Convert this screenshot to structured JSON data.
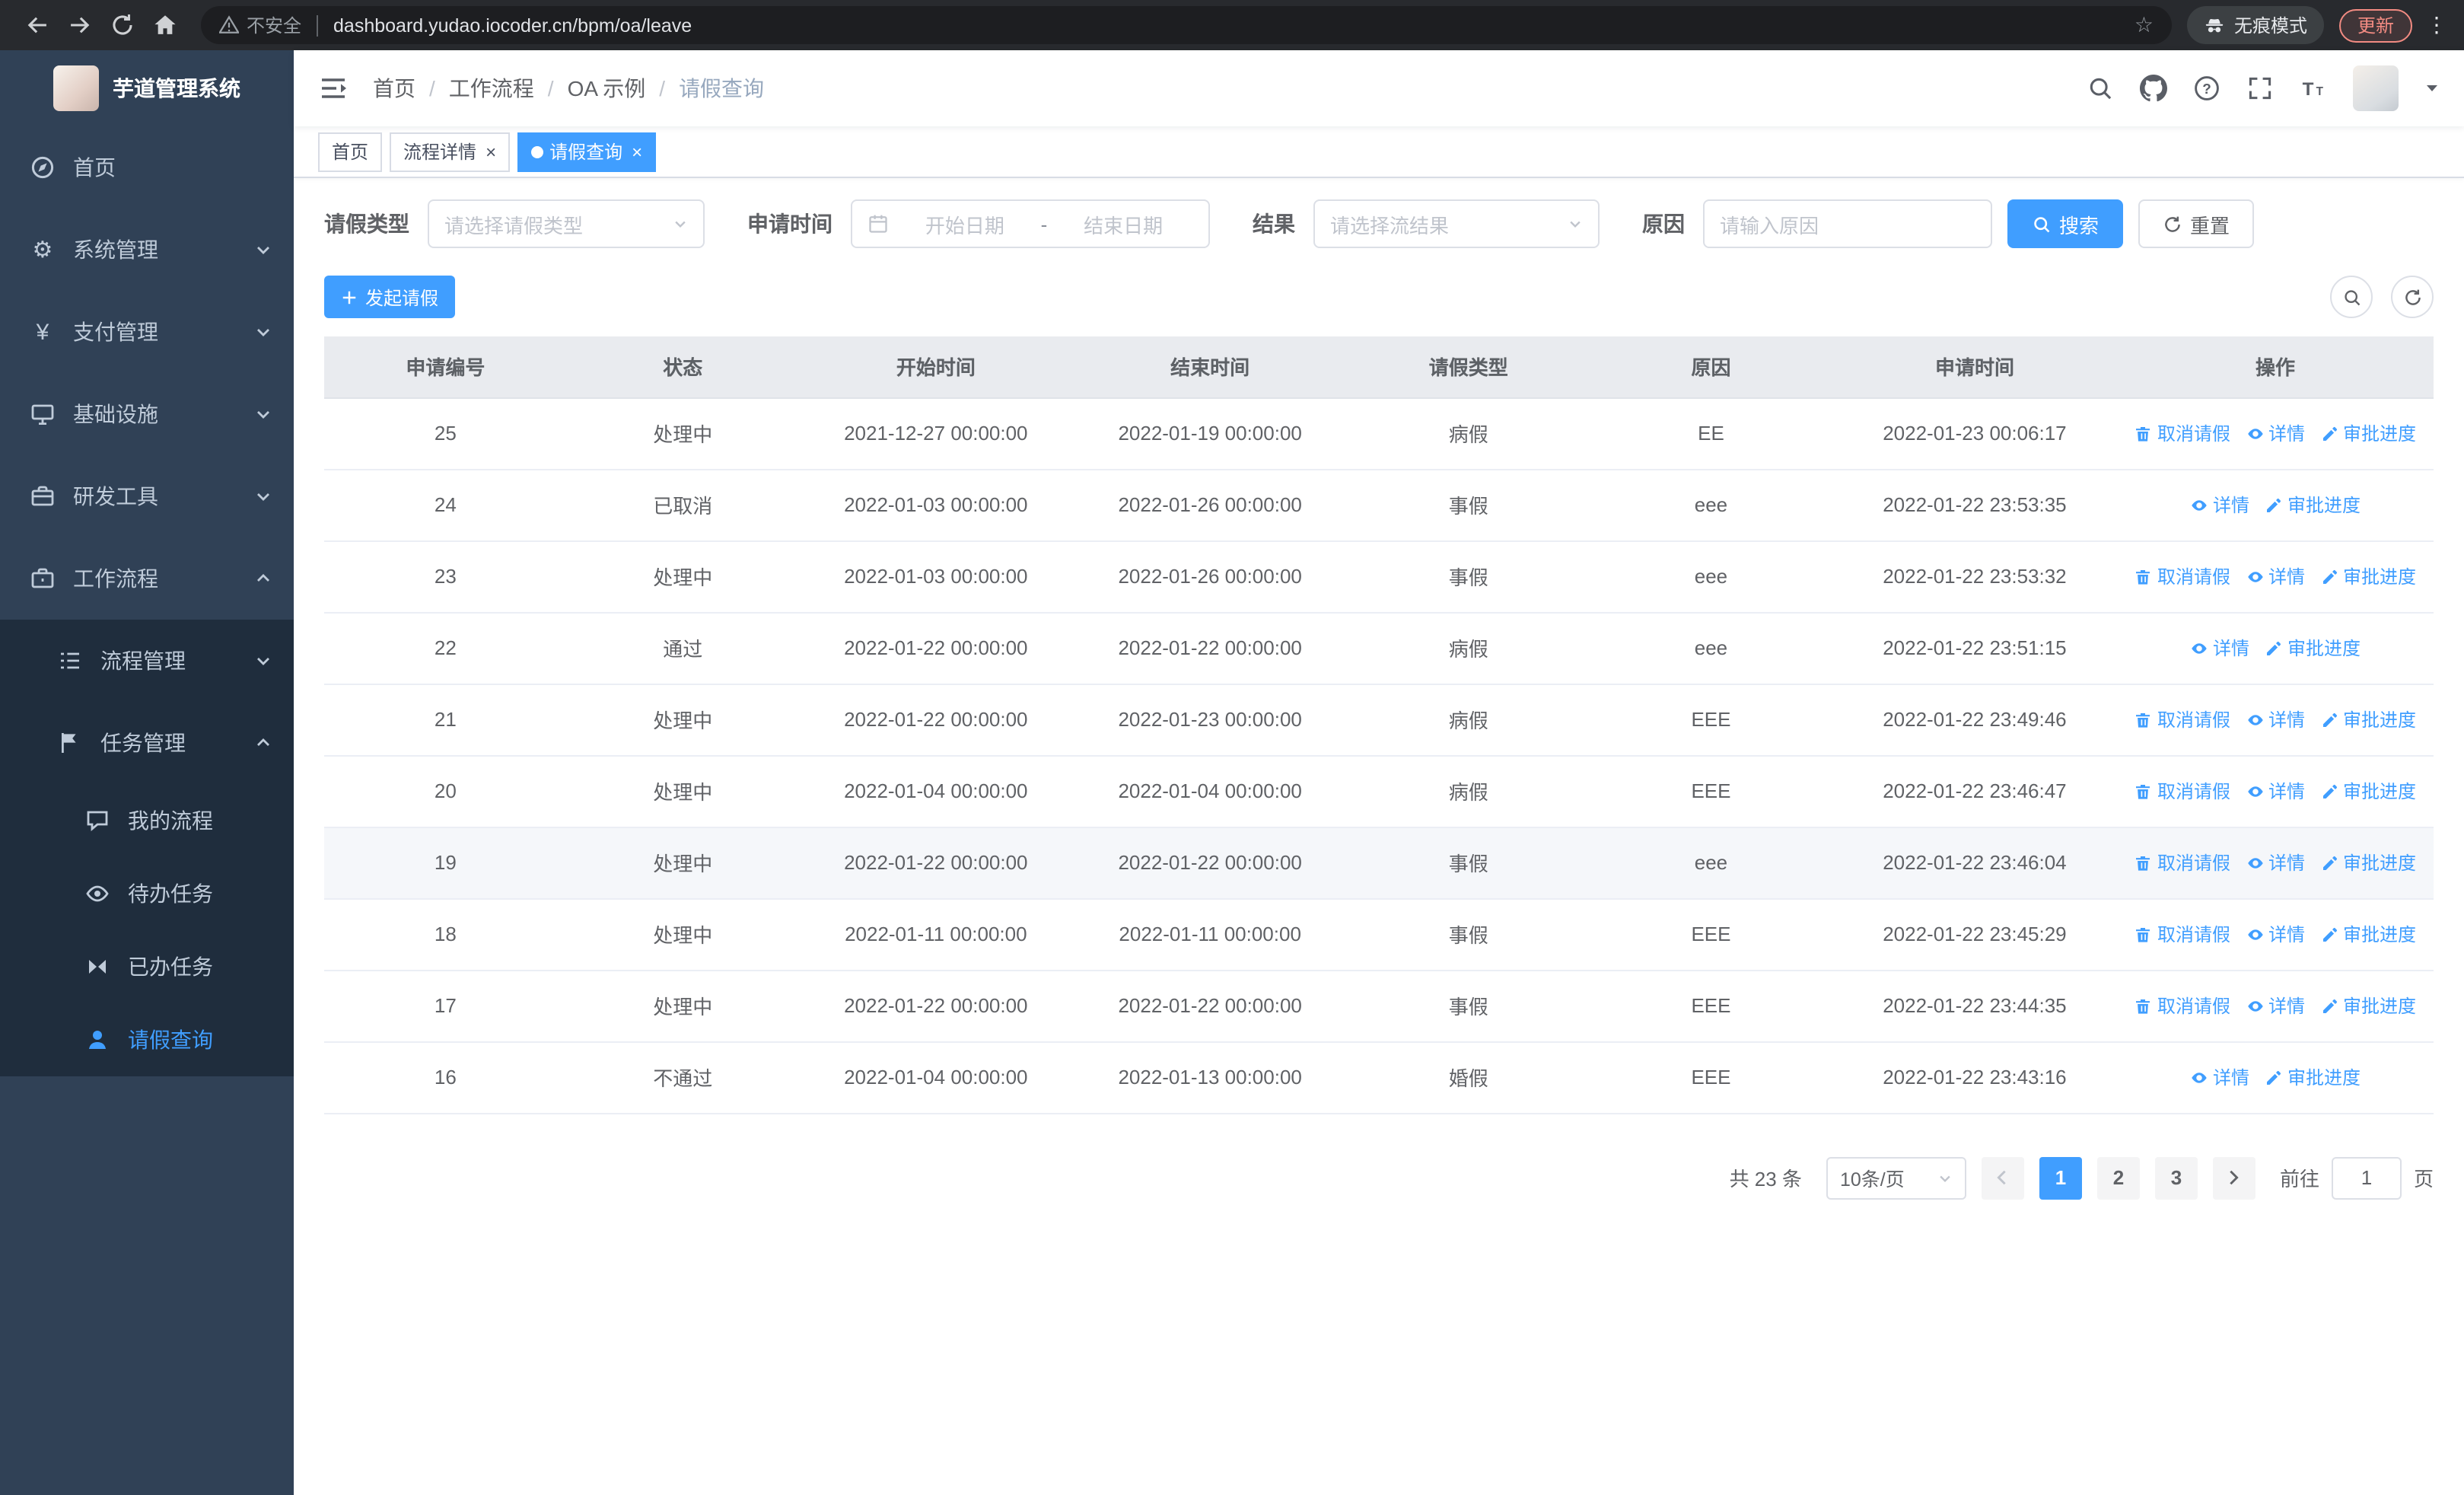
{
  "browser": {
    "security_label": "不安全",
    "url": "dashboard.yudao.iocoder.cn/bpm/oa/leave",
    "incognito_label": "无痕模式",
    "update_label": "更新"
  },
  "sidebar": {
    "title": "芋道管理系统",
    "items": [
      {
        "label": "首页"
      },
      {
        "label": "系统管理"
      },
      {
        "label": "支付管理"
      },
      {
        "label": "基础设施"
      },
      {
        "label": "研发工具"
      },
      {
        "label": "工作流程"
      },
      {
        "label": "流程管理"
      },
      {
        "label": "任务管理"
      },
      {
        "label": "我的流程"
      },
      {
        "label": "待办任务"
      },
      {
        "label": "已办任务"
      },
      {
        "label": "请假查询"
      }
    ]
  },
  "header": {
    "breadcrumb": [
      "首页",
      "工作流程",
      "OA 示例",
      "请假查询"
    ],
    "separator": "/"
  },
  "tabs": [
    {
      "label": "首页"
    },
    {
      "label": "流程详情"
    },
    {
      "label": "请假查询"
    }
  ],
  "filters": {
    "leave_type_label": "请假类型",
    "leave_type_placeholder": "请选择请假类型",
    "apply_time_label": "申请时间",
    "start_placeholder": "开始日期",
    "range_separator": "-",
    "end_placeholder": "结束日期",
    "result_label": "结果",
    "result_placeholder": "请选择流结果",
    "reason_label": "原因",
    "reason_placeholder": "请输入原因",
    "search_label": "搜索",
    "reset_label": "重置"
  },
  "toolbar": {
    "create_label": "发起请假"
  },
  "table": {
    "columns": [
      "申请编号",
      "状态",
      "开始时间",
      "结束时间",
      "请假类型",
      "原因",
      "申请时间",
      "操作"
    ],
    "action_labels": {
      "cancel": "取消请假",
      "detail": "详情",
      "progress": "审批进度"
    },
    "rows": [
      {
        "id": "25",
        "status": "处理中",
        "start": "2021-12-27 00:00:00",
        "end": "2022-01-19 00:00:00",
        "type": "病假",
        "reason": "EE",
        "apply_time": "2022-01-23 00:06:17",
        "cancellable": true
      },
      {
        "id": "24",
        "status": "已取消",
        "start": "2022-01-03 00:00:00",
        "end": "2022-01-26 00:00:00",
        "type": "事假",
        "reason": "eee",
        "apply_time": "2022-01-22 23:53:35",
        "cancellable": false
      },
      {
        "id": "23",
        "status": "处理中",
        "start": "2022-01-03 00:00:00",
        "end": "2022-01-26 00:00:00",
        "type": "事假",
        "reason": "eee",
        "apply_time": "2022-01-22 23:53:32",
        "cancellable": true
      },
      {
        "id": "22",
        "status": "通过",
        "start": "2022-01-22 00:00:00",
        "end": "2022-01-22 00:00:00",
        "type": "病假",
        "reason": "eee",
        "apply_time": "2022-01-22 23:51:15",
        "cancellable": false
      },
      {
        "id": "21",
        "status": "处理中",
        "start": "2022-01-22 00:00:00",
        "end": "2022-01-23 00:00:00",
        "type": "病假",
        "reason": "EEE",
        "apply_time": "2022-01-22 23:49:46",
        "cancellable": true
      },
      {
        "id": "20",
        "status": "处理中",
        "start": "2022-01-04 00:00:00",
        "end": "2022-01-04 00:00:00",
        "type": "病假",
        "reason": "EEE",
        "apply_time": "2022-01-22 23:46:47",
        "cancellable": true
      },
      {
        "id": "19",
        "status": "处理中",
        "start": "2022-01-22 00:00:00",
        "end": "2022-01-22 00:00:00",
        "type": "事假",
        "reason": "eee",
        "apply_time": "2022-01-22 23:46:04",
        "cancellable": true,
        "highlight": true
      },
      {
        "id": "18",
        "status": "处理中",
        "start": "2022-01-11 00:00:00",
        "end": "2022-01-11 00:00:00",
        "type": "事假",
        "reason": "EEE",
        "apply_time": "2022-01-22 23:45:29",
        "cancellable": true
      },
      {
        "id": "17",
        "status": "处理中",
        "start": "2022-01-22 00:00:00",
        "end": "2022-01-22 00:00:00",
        "type": "事假",
        "reason": "EEE",
        "apply_time": "2022-01-22 23:44:35",
        "cancellable": true
      },
      {
        "id": "16",
        "status": "不通过",
        "start": "2022-01-04 00:00:00",
        "end": "2022-01-13 00:00:00",
        "type": "婚假",
        "reason": "EEE",
        "apply_time": "2022-01-22 23:43:16",
        "cancellable": false
      }
    ]
  },
  "pagination": {
    "total": "共 23 条",
    "page_size": "10条/页",
    "pages": [
      "1",
      "2",
      "3"
    ],
    "goto_label": "前往",
    "goto_value": "1",
    "page_unit": "页"
  }
}
